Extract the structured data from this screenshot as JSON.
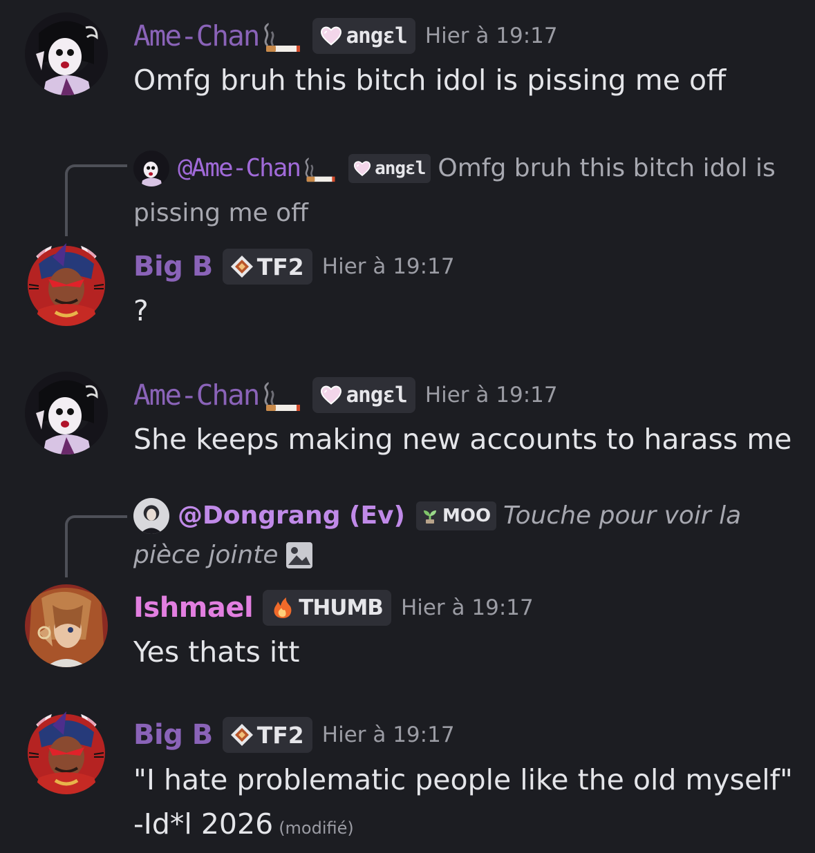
{
  "messages": [
    {
      "username": "Ame-Chan",
      "tag": "angɛl",
      "time": "Hier à 19:17",
      "text": "Omfg bruh this bitch idol is pissing me off"
    },
    {
      "reply": {
        "username": "@Ame-Chan",
        "tag": "angɛl",
        "text": "Omfg bruh this bitch idol is pissing me off"
      },
      "username": "Big B",
      "tag": "TF2",
      "time": "Hier à 19:17",
      "text": "?"
    },
    {
      "username": "Ame-Chan",
      "tag": "angɛl",
      "time": "Hier à 19:17",
      "text": "She keeps making new accounts to harass me"
    },
    {
      "reply": {
        "username": "@Dongrang (Ev)",
        "tag": "MOO",
        "text": "Touche pour voir la pièce jointe"
      },
      "username": "Ishmael",
      "tag": "THUMB",
      "time": "Hier à 19:17",
      "text": "Yes thats itt"
    },
    {
      "username": "Big B",
      "tag": "TF2",
      "time": "Hier à 19:17",
      "text_line1": "\"I hate problematic people like the old myself\"",
      "text_line2": "-Id*l 2026",
      "edited": "(modifié)"
    }
  ],
  "icons": {
    "cigarette": "cigarette-icon",
    "heart": "heart-icon",
    "tf2": "tf2-diamond-icon",
    "moo": "sprout-icon",
    "thumb": "fire-icon",
    "image": "image-attachment-icon"
  },
  "colors": {
    "background": "#1c1d22",
    "ame_name": "#8a63b8",
    "bigb_name": "#8a63b8",
    "ishmael_name": "#e27fe0",
    "tag_bg": "#2e2f36",
    "timestamp": "#9b9ca4"
  }
}
